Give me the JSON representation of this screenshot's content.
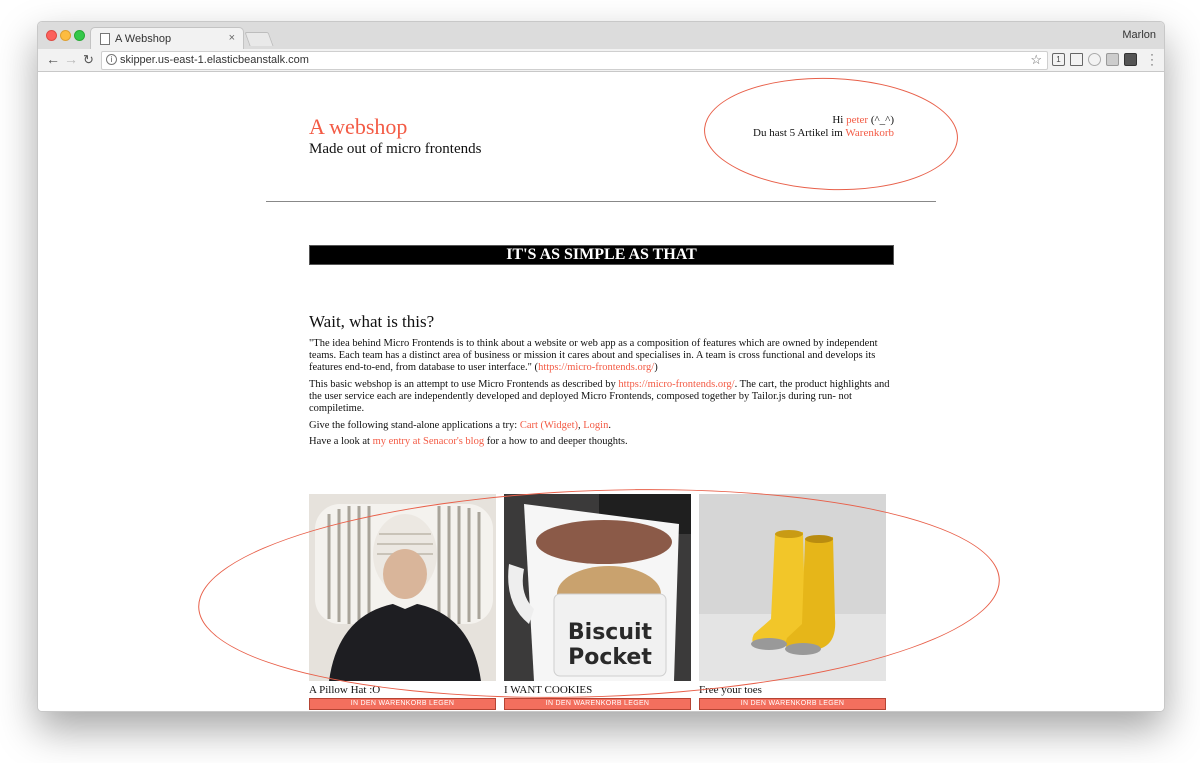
{
  "browser": {
    "tab_title": "A Webshop",
    "tab_close": "×",
    "profile_name": "Marlon",
    "url": "skipper.us-east-1.elasticbeanstalk.com",
    "back_glyph": "←",
    "forward_glyph": "→",
    "reload_glyph": "↻",
    "star_glyph": "☆",
    "extensions": [
      "1",
      "",
      "",
      "",
      "",
      ""
    ]
  },
  "header": {
    "title": "A webshop",
    "subtitle": "Made out of micro frontends"
  },
  "user_widget": {
    "greeting_prefix": "Hi ",
    "user_name": "peter",
    "greeting_suffix": " (^_^)",
    "cart_prefix": "Du hast 5 Artikel im ",
    "cart_link": "Warenkorb"
  },
  "banner": {
    "text": "IT'S AS SIMPLE AS THAT"
  },
  "intro": {
    "heading": "Wait, what is this?",
    "quote_text": "\"The idea behind Micro Frontends is to think about a website or web app as a composition of features which are owned by independent teams. Each team has a distinct area of business or mission it cares about and specialises in. A team is cross functional and develops its features end-to-end, from database to user interface.\" (",
    "quote_link": "https://micro-frontends.org/",
    "quote_end": ")",
    "p2_text": "This basic webshop is an attempt to use Micro Frontends as described by ",
    "p2_link": "https://micro-frontends.org/",
    "p2_rest": ". The cart, the product highlights and the user service each are independently developed and deployed Micro Frontends, composed together by Tailor.js during run- not compiletime.",
    "p3_text": "Give the following stand-alone applications a try: ",
    "p3_link1": "Cart (Widget)",
    "p3_sep": ", ",
    "p3_link2": "Login",
    "p3_end": ".",
    "p4_text": "Have a look at ",
    "p4_link": "my entry at Senacor's blog",
    "p4_rest": " for a how to and deeper thoughts."
  },
  "products": [
    {
      "name": "A Pillow Hat :O",
      "button": "IN DEN WARENKORB LEGEN"
    },
    {
      "name": "I WANT COOKIES",
      "button": "IN DEN WARENKORB LEGEN",
      "mug_line1": "Biscuit",
      "mug_line2": "Pocket"
    },
    {
      "name": "Free your toes",
      "button": "IN DEN WARENKORB LEGEN"
    }
  ],
  "colors": {
    "accent": "#f35b45",
    "annotation": "#e8604a",
    "button": "#f36f5e"
  }
}
